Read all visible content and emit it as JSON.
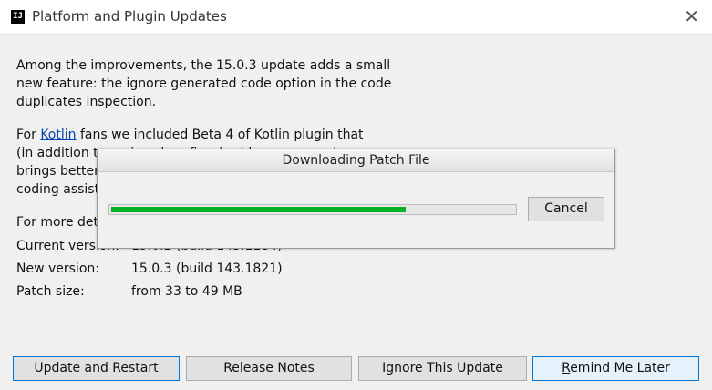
{
  "window": {
    "title": "Platform and Plugin Updates",
    "app_icon_text": "IJ",
    "close_glyph": "✕"
  },
  "content": {
    "para1": "Among the improvements, the 15.0.3 update adds a small\nnew feature: the ignore generated code option in the code\nduplicates inspection.",
    "para2_prefix": "For ",
    "para2_link": "Kotlin",
    "para2_rest": " fans we included Beta 4 of Kotlin plugin that\n(in addition to various bug fixes) adds many new language\nbrings better performance and improved tooling for\ncoding assistance.",
    "para3": "For more details see release notes."
  },
  "info": {
    "current_label": "Current version:",
    "current_value": "15.0.2 (build 143.1184)",
    "new_label": "New version:",
    "new_value": "15.0.3 (build 143.1821)",
    "patch_label": "Patch size:",
    "patch_value": "from 33 to 49 MB"
  },
  "buttons": {
    "update": "Update and Restart",
    "release_notes": "Release Notes",
    "ignore": "Ignore This Update",
    "remind_first": "R",
    "remind_rest": "emind Me Later"
  },
  "progress_dialog": {
    "title": "Downloading Patch File",
    "cancel": "Cancel",
    "progress_fraction": 0.73,
    "progress_color": "#06b025"
  }
}
